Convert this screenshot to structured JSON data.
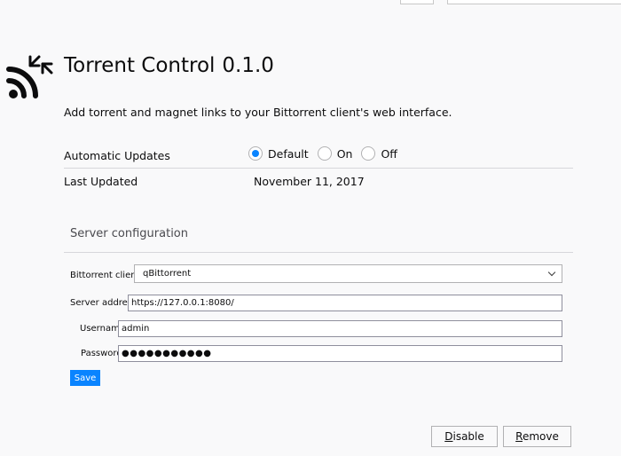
{
  "addon": {
    "name": "Torrent Control",
    "version": "0.1.0",
    "description": "Add torrent and magnet links to your Bittorrent client's web interface.",
    "icon": "torrent-control-icon"
  },
  "details": {
    "automatic_updates": {
      "label": "Automatic Updates",
      "options": [
        {
          "label": "Default",
          "checked": true
        },
        {
          "label": "On",
          "checked": false
        },
        {
          "label": "Off",
          "checked": false
        }
      ]
    },
    "last_updated": {
      "label": "Last Updated",
      "value": "November 11, 2017"
    }
  },
  "server_config": {
    "title": "Server configuration",
    "client": {
      "label": "Bittorrent client",
      "value": "qBittorrent"
    },
    "address": {
      "label": "Server address",
      "value": "https://127.0.0.1:8080/"
    },
    "username": {
      "label": "Username",
      "value": "admin"
    },
    "password": {
      "label": "Password",
      "value": "●●●●●●●●●●●"
    },
    "save_label": "Save"
  },
  "footer": {
    "disable_first": "D",
    "disable_rest": "isable",
    "remove_first": "R",
    "remove_rest": "emove"
  },
  "colors": {
    "accent": "#0a84ff",
    "text": "#0c0c0d",
    "background": "#f9f9fa"
  }
}
